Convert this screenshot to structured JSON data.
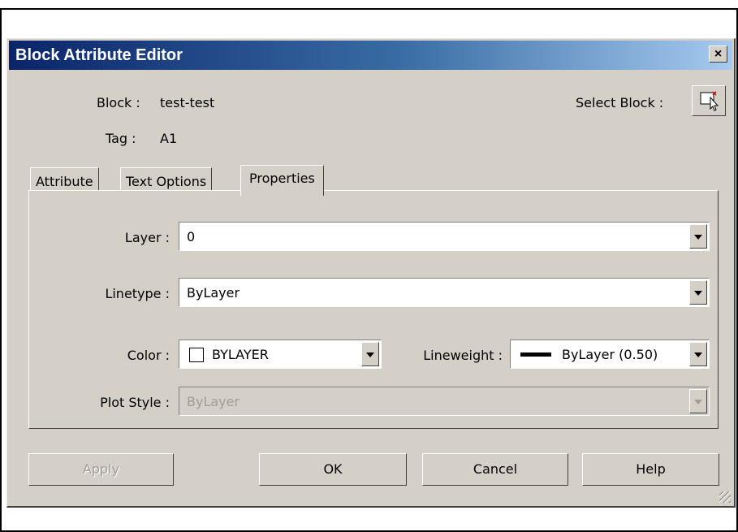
{
  "dialog": {
    "title": "Block Attribute Editor",
    "close_label": "×"
  },
  "info": {
    "block_label": "Block :",
    "block_value": "test-test",
    "tag_label": "Tag :",
    "tag_value": "A1",
    "select_block_label": "Select Block :",
    "select_block_icon": "select-object-cursor-icon"
  },
  "tabs": [
    {
      "label": "Attribute",
      "active": false
    },
    {
      "label": "Text Options",
      "active": false
    },
    {
      "label": "Properties",
      "active": true
    }
  ],
  "properties": {
    "layer_label": "Layer :",
    "layer_value": "0",
    "linetype_label": "Linetype :",
    "linetype_value": "ByLayer",
    "color_label": "Color :",
    "color_value": "BYLAYER",
    "lineweight_label": "Lineweight :",
    "lineweight_value": "ByLayer (0.50)",
    "plotstyle_label": "Plot Style :",
    "plotstyle_value": "ByLayer",
    "plotstyle_disabled": true
  },
  "buttons": {
    "apply": "Apply",
    "ok": "OK",
    "cancel": "Cancel",
    "help": "Help"
  },
  "colors": {
    "titlebar_start": "#0a246a",
    "titlebar_end": "#a6caf0",
    "dialog_bg": "#d4d0c8",
    "disabled_text": "#a09d95"
  }
}
